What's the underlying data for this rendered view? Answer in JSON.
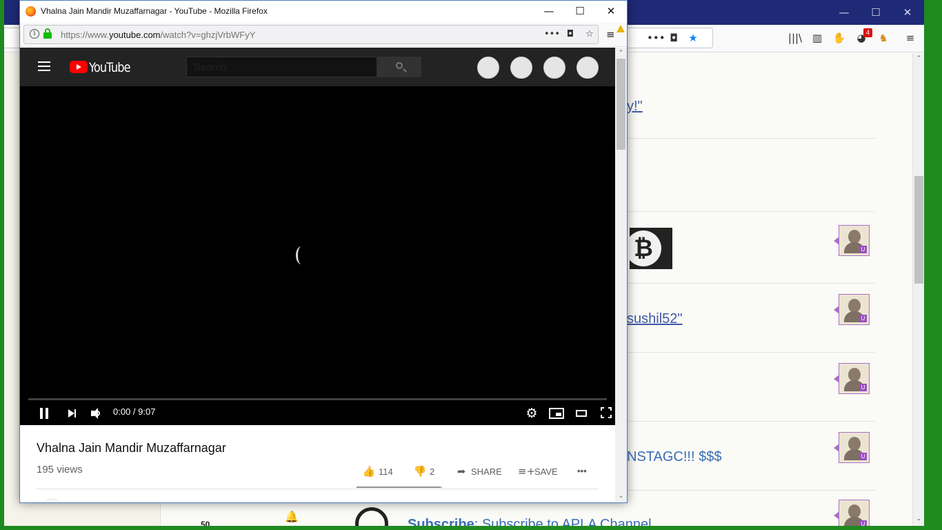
{
  "background_window": {
    "toolbar": {
      "more": "•••",
      "pocket": "◘",
      "bookmark": "★",
      "library": "|||\\",
      "sidebar": "▥",
      "menu": "≡",
      "notification_count": "4"
    },
    "scroll_arrow_up": "⌃",
    "scroll_arrow_down": "⌄",
    "rows": [
      {
        "text": "y!\"",
        "style": "link"
      },
      {
        "text": "",
        "style": "plain"
      },
      {
        "text": "",
        "style": "image"
      },
      {
        "text": "sushil52\"",
        "style": "link"
      },
      {
        "text": "",
        "style": "plain"
      },
      {
        "text": "NSTAGC!!! $$$",
        "style": "plain"
      }
    ],
    "bitcoin_symbol": "₿",
    "bottom_bar": {
      "count": "50",
      "subscribe_label": "Subscribe",
      "subscribe_text": ": Subscribe to APLA Channel"
    },
    "window_buttons": {
      "minimize": "—",
      "maximize": "☐",
      "close": "✕"
    }
  },
  "foreground_window": {
    "title": "Vhalna Jain Mandir Muzaffarnagar - YouTube - Mozilla Firefox",
    "window_buttons": {
      "minimize": "—",
      "maximize": "☐",
      "close": "✕"
    },
    "url_prefix": "https://www.",
    "url_domain": "youtube.com",
    "url_path": "/watch?v=ghzjVrbWFyY",
    "url_icons": {
      "more": "•••",
      "pocket": "◘",
      "bookmark": "☆"
    },
    "info_icon": "i",
    "menu": "≡"
  },
  "youtube": {
    "logo_text": "YouTube",
    "search_placeholder": "Search",
    "player": {
      "current_time": "0:00",
      "duration": "9:07",
      "time_display": "0:00 / 9:07",
      "progress": 0,
      "settings_icon": "⚙"
    },
    "video": {
      "title": "Vhalna Jain Mandir Muzaffarnagar",
      "views": "195 views",
      "likes": "114",
      "dislikes": "2",
      "share_label": "SHARE",
      "save_label": "SAVE",
      "more": "•••",
      "like_icon": "👍",
      "dislike_icon": "👎",
      "share_icon": "➦",
      "save_icon": "≡+",
      "like_ratio": 0.983
    }
  },
  "colors": {
    "desktop": "#1f8a1f",
    "bg_titlebar": "#1f2a77",
    "yt_masthead": "#232323",
    "yt_red": "#ff0000",
    "link": "#3a6db5"
  }
}
